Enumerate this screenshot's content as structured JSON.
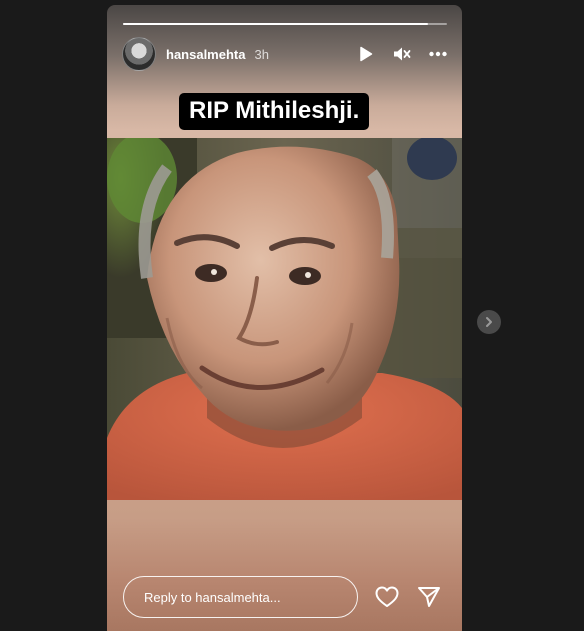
{
  "story": {
    "progress_fraction": 0.94,
    "username": "hansalmehta",
    "time_ago": "3h",
    "caption": "RIP Mithileshji.",
    "photo_description_icon": "portrait-photo",
    "reply": {
      "placeholder": "Reply to hansalmehta..."
    }
  },
  "icons": {
    "play": "play-icon",
    "mute": "speaker-muted-icon",
    "more": "more-horizontal-icon",
    "like": "heart-icon",
    "share": "send-icon",
    "next": "chevron-right-icon"
  },
  "colors": {
    "page_background": "#1a1a1a",
    "caption_background": "#000000",
    "text": "#ffffff",
    "shirt": "#d4674a"
  }
}
